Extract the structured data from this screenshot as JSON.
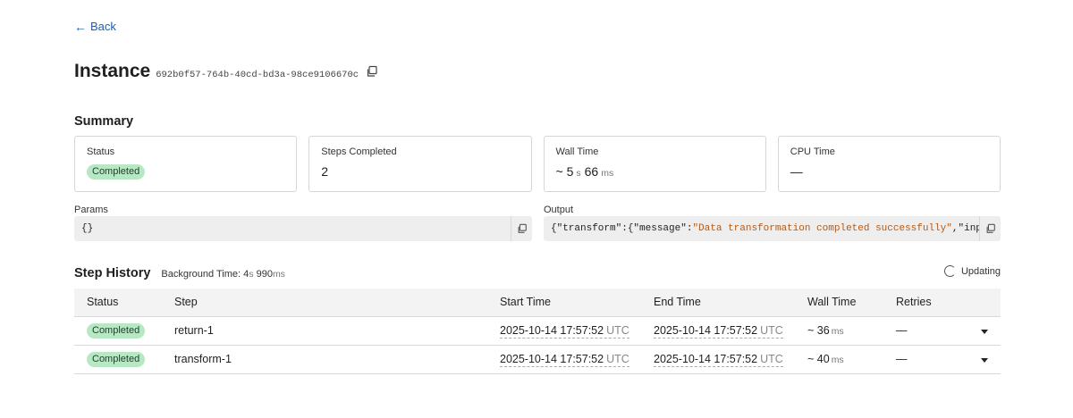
{
  "nav": {
    "back_label": "Back"
  },
  "header": {
    "title": "Instance",
    "instance_id": "692b0f57-764b-40cd-bd3a-98ce9106670c"
  },
  "summary": {
    "title": "Summary",
    "status": {
      "label": "Status",
      "value": "Completed"
    },
    "steps_completed": {
      "label": "Steps Completed",
      "value": "2"
    },
    "wall_time": {
      "label": "Wall Time",
      "prefix": "~ ",
      "seconds": "5",
      "seconds_unit": "s",
      "ms": "66",
      "ms_unit": "ms"
    },
    "cpu_time": {
      "label": "CPU Time",
      "value": "—"
    }
  },
  "params": {
    "label": "Params",
    "value": "{}"
  },
  "output": {
    "label": "Output",
    "part1": "{\"transform\":{\"message\":",
    "part2": "\"Data transformation completed successfully\"",
    "part3": ",\"inputData\":{"
  },
  "step_history": {
    "title": "Step History",
    "background_time_label": "Background Time:",
    "background_time_s": "4",
    "background_time_s_unit": "s",
    "background_time_ms": "990",
    "background_time_ms_unit": "ms",
    "updating_label": "Updating",
    "columns": [
      "Status",
      "Step",
      "Start Time",
      "End Time",
      "Wall Time",
      "Retries"
    ],
    "rows": [
      {
        "status": "Completed",
        "step": "return-1",
        "start_time": "2025-10-14 17:57:52",
        "start_tz": "UTC",
        "end_time": "2025-10-14 17:57:52",
        "end_tz": "UTC",
        "wall_prefix": "~ ",
        "wall_value": "36",
        "wall_unit": "ms",
        "retries": "—"
      },
      {
        "status": "Completed",
        "step": "transform-1",
        "start_time": "2025-10-14 17:57:52",
        "start_tz": "UTC",
        "end_time": "2025-10-14 17:57:52",
        "end_tz": "UTC",
        "wall_prefix": "~ ",
        "wall_value": "40",
        "wall_unit": "ms",
        "retries": "—"
      }
    ]
  },
  "colors": {
    "link": "#1a5fb4",
    "badge_bg": "#b7e8c4",
    "json_string": "#b35a17"
  }
}
